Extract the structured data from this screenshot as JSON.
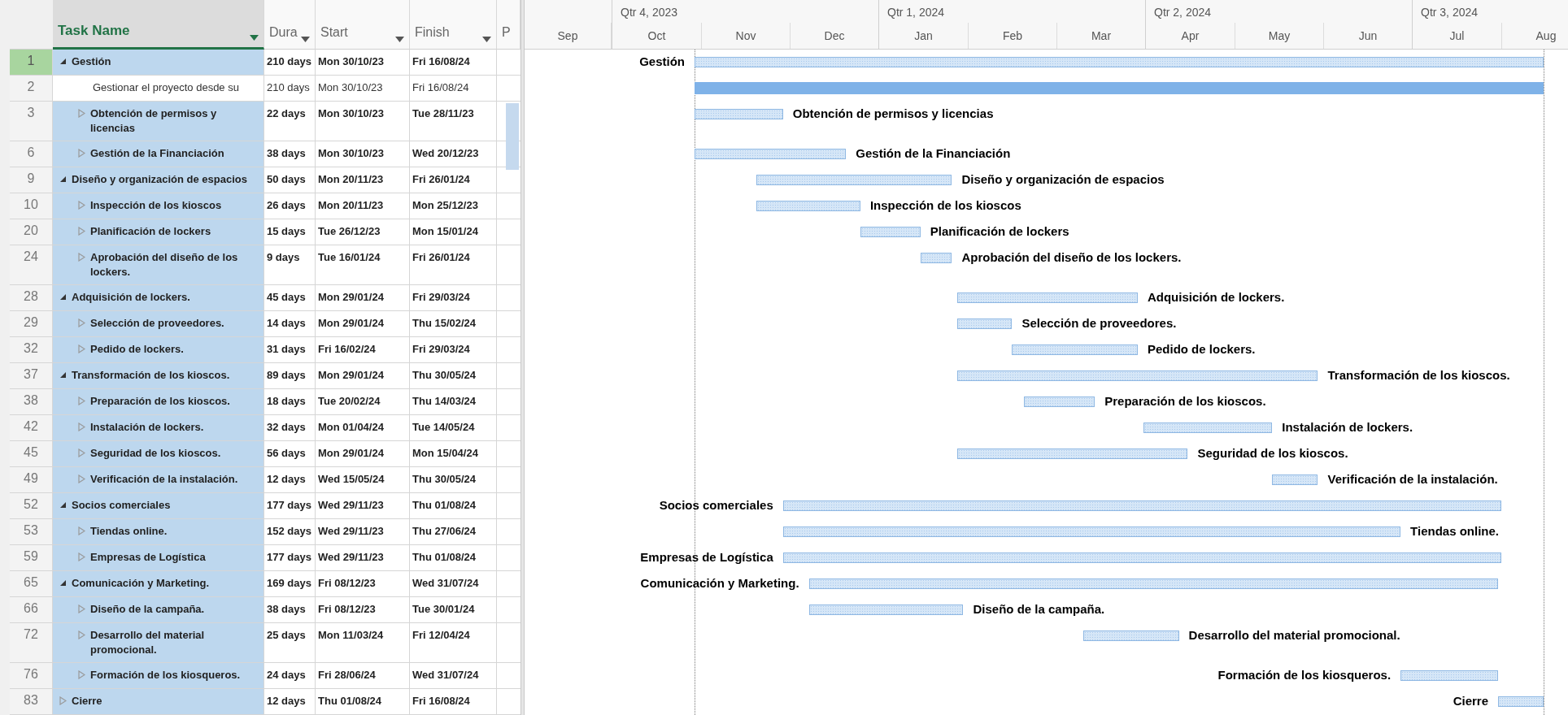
{
  "columns": [
    {
      "label": "Task Name",
      "selected": true
    },
    {
      "label": "Dura",
      "selected": false
    },
    {
      "label": "Start",
      "selected": false
    },
    {
      "label": "Finish",
      "selected": false
    },
    {
      "label": "P",
      "selected": false
    }
  ],
  "timescale": {
    "leading_months": [
      "Sep"
    ],
    "quarters": [
      {
        "label": "Qtr 4, 2023",
        "months": [
          "Oct",
          "Nov",
          "Dec"
        ]
      },
      {
        "label": "Qtr 1, 2024",
        "months": [
          "Jan",
          "Feb",
          "Mar"
        ]
      },
      {
        "label": "Qtr 2, 2024",
        "months": [
          "Apr",
          "May",
          "Jun"
        ]
      },
      {
        "label": "Qtr 3, 2024",
        "months": [
          "Jul",
          "Aug"
        ]
      }
    ]
  },
  "rows": [
    {
      "row_number": "1",
      "name": "Gestión",
      "kind": "summary",
      "expanded": true,
      "selected": true,
      "highlighted": true,
      "duration": "210 days",
      "start": "Mon 30/10/23",
      "finish": "Fri 16/08/24",
      "bar_label": "Gestión",
      "children": [
        {
          "row_number": "2",
          "name": "Gestionar el proyecto desde su",
          "kind": "task",
          "selected": false,
          "highlighted": false,
          "duration": "210 days",
          "start": "Mon 30/10/23",
          "finish": "Fri 16/08/24"
        },
        {
          "row_number": "3",
          "name": "Obtención de permisos y licencias",
          "kind": "summary",
          "expanded": false,
          "selected": false,
          "highlighted": true,
          "duration": "22 days",
          "start": "Mon 30/10/23",
          "finish": "Tue 28/11/23",
          "bar_label": "Obtención de permisos y licencias"
        },
        {
          "row_number": "6",
          "name": "Gestión de la Financiación",
          "kind": "summary",
          "expanded": false,
          "selected": false,
          "highlighted": true,
          "duration": "38 days",
          "start": "Mon 30/10/23",
          "finish": "Wed 20/12/23",
          "bar_label": "Gestión de la Financiación"
        }
      ]
    },
    {
      "row_number": "9",
      "name": "Diseño y organización de espacios",
      "kind": "summary",
      "expanded": true,
      "selected": false,
      "highlighted": true,
      "duration": "50 days",
      "start": "Mon 20/11/23",
      "finish": "Fri 26/01/24",
      "bar_label": "Diseño y organización de espacios",
      "children": [
        {
          "row_number": "10",
          "name": "Inspección de los kioscos",
          "kind": "summary",
          "expanded": false,
          "selected": false,
          "highlighted": true,
          "duration": "26 days",
          "start": "Mon 20/11/23",
          "finish": "Mon 25/12/23",
          "bar_label": "Inspección de los kioscos"
        },
        {
          "row_number": "20",
          "name": "Planificación de lockers",
          "kind": "summary",
          "expanded": false,
          "selected": false,
          "highlighted": true,
          "duration": "15 days",
          "start": "Tue 26/12/23",
          "finish": "Mon 15/01/24",
          "bar_label": "Planificación de lockers"
        },
        {
          "row_number": "24",
          "name": "Aprobación del diseño de los lockers.",
          "kind": "summary",
          "expanded": false,
          "selected": false,
          "highlighted": true,
          "duration": "9 days",
          "start": "Tue 16/01/24",
          "finish": "Fri 26/01/24",
          "bar_label": "Aprobación del diseño de los lockers."
        }
      ]
    },
    {
      "row_number": "28",
      "name": "Adquisición de lockers.",
      "kind": "summary",
      "expanded": true,
      "selected": false,
      "highlighted": true,
      "duration": "45 days",
      "start": "Mon 29/01/24",
      "finish": "Fri 29/03/24",
      "bar_label": "Adquisición de lockers.",
      "children": [
        {
          "row_number": "29",
          "name": "Selección de proveedores.",
          "kind": "summary",
          "expanded": false,
          "selected": false,
          "highlighted": true,
          "duration": "14 days",
          "start": "Mon 29/01/24",
          "finish": "Thu 15/02/24",
          "bar_label": "Selección de proveedores."
        },
        {
          "row_number": "32",
          "name": "Pedido de lockers.",
          "kind": "summary",
          "expanded": false,
          "selected": false,
          "highlighted": true,
          "duration": "31 days",
          "start": "Fri 16/02/24",
          "finish": "Fri 29/03/24",
          "bar_label": "Pedido de lockers."
        }
      ]
    },
    {
      "row_number": "37",
      "name": "Transformación de los kioscos.",
      "kind": "summary",
      "expanded": true,
      "selected": false,
      "highlighted": true,
      "duration": "89 days",
      "start": "Mon 29/01/24",
      "finish": "Thu 30/05/24",
      "bar_label": "Transformación de los kioscos.",
      "children": [
        {
          "row_number": "38",
          "name": "Preparación de los kioscos.",
          "kind": "summary",
          "expanded": false,
          "selected": false,
          "highlighted": true,
          "duration": "18 days",
          "start": "Tue 20/02/24",
          "finish": "Thu 14/03/24",
          "bar_label": "Preparación de los kioscos."
        },
        {
          "row_number": "42",
          "name": "Instalación de lockers.",
          "kind": "summary",
          "expanded": false,
          "selected": false,
          "highlighted": true,
          "duration": "32 days",
          "start": "Mon 01/04/24",
          "finish": "Tue 14/05/24",
          "bar_label": "Instalación de lockers."
        },
        {
          "row_number": "45",
          "name": "Seguridad de los kioscos.",
          "kind": "summary",
          "expanded": false,
          "selected": false,
          "highlighted": true,
          "duration": "56 days",
          "start": "Mon 29/01/24",
          "finish": "Mon 15/04/24",
          "bar_label": "Seguridad de los kioscos."
        },
        {
          "row_number": "49",
          "name": "Verificación de la instalación.",
          "kind": "summary",
          "expanded": false,
          "selected": false,
          "highlighted": true,
          "duration": "12 days",
          "start": "Wed 15/05/24",
          "finish": "Thu 30/05/24",
          "bar_label": "Verificación de la instalación."
        }
      ]
    },
    {
      "row_number": "52",
      "name": "Socios comerciales",
      "kind": "summary",
      "expanded": true,
      "selected": false,
      "highlighted": true,
      "duration": "177 days",
      "start": "Wed 29/11/23",
      "finish": "Thu 01/08/24",
      "bar_label": "Socios comerciales",
      "children": [
        {
          "row_number": "53",
          "name": "Tiendas online.",
          "kind": "summary",
          "expanded": false,
          "selected": false,
          "highlighted": true,
          "duration": "152 days",
          "start": "Wed 29/11/23",
          "finish": "Thu 27/06/24",
          "bar_label": "Tiendas online."
        },
        {
          "row_number": "59",
          "name": "Empresas de Logística",
          "kind": "summary",
          "expanded": false,
          "selected": false,
          "highlighted": true,
          "duration": "177 days",
          "start": "Wed 29/11/23",
          "finish": "Thu 01/08/24",
          "bar_label": "Empresas de Logística"
        }
      ]
    },
    {
      "row_number": "65",
      "name": "Comunicación y Marketing.",
      "kind": "summary",
      "expanded": true,
      "selected": false,
      "highlighted": true,
      "duration": "169 days",
      "start": "Fri 08/12/23",
      "finish": "Wed 31/07/24",
      "bar_label": "Comunicación y Marketing.",
      "children": [
        {
          "row_number": "66",
          "name": "Diseño de la campaña.",
          "kind": "summary",
          "expanded": false,
          "selected": false,
          "highlighted": true,
          "duration": "38 days",
          "start": "Fri 08/12/23",
          "finish": "Tue 30/01/24",
          "bar_label": "Diseño de la campaña."
        },
        {
          "row_number": "72",
          "name": "Desarrollo del material promocional.",
          "kind": "summary",
          "expanded": false,
          "selected": false,
          "highlighted": true,
          "duration": "25 days",
          "start": "Mon 11/03/24",
          "finish": "Fri 12/04/24",
          "bar_label": "Desarrollo del material promocional."
        },
        {
          "row_number": "76",
          "name": "Formación de los kiosqueros.",
          "kind": "summary",
          "expanded": false,
          "selected": false,
          "highlighted": true,
          "duration": "24 days",
          "start": "Fri 28/06/24",
          "finish": "Wed 31/07/24",
          "bar_label": "Formación de los kiosqueros."
        }
      ]
    },
    {
      "row_number": "83",
      "name": "Cierre",
      "kind": "summary",
      "expanded": false,
      "selected": false,
      "highlighted": true,
      "duration": "12 days",
      "start": "Thu 01/08/24",
      "finish": "Fri 16/08/24",
      "bar_label": "Cierre"
    }
  ]
}
